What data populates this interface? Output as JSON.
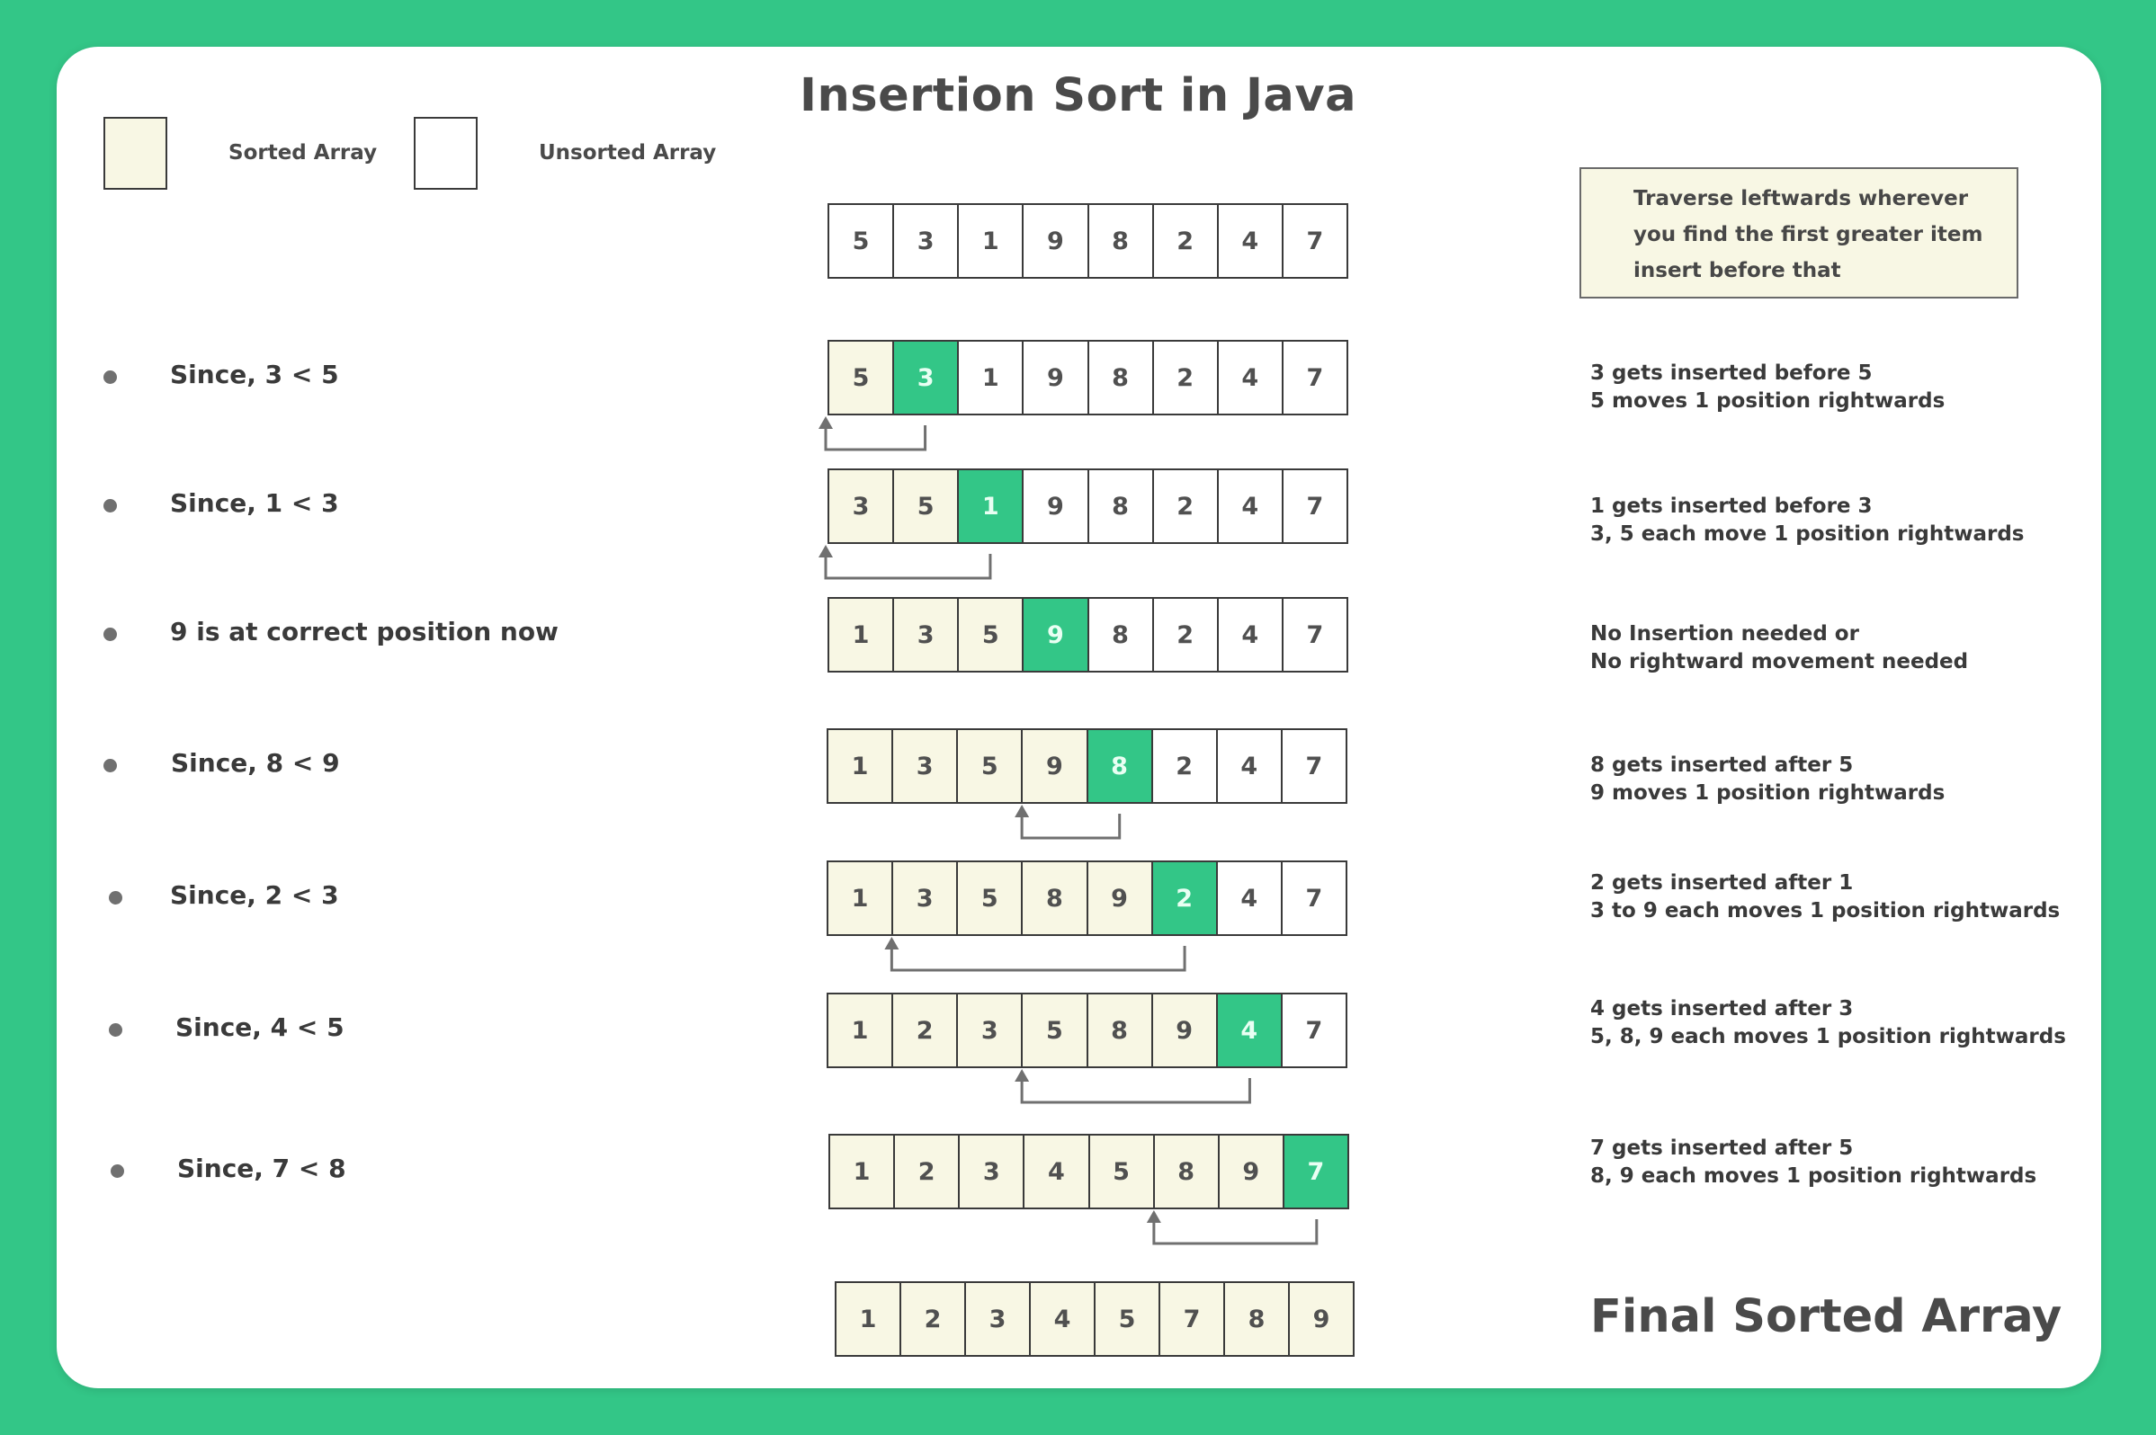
{
  "title": "Insertion Sort in Java",
  "legend": {
    "sorted_label": "Sorted Array",
    "unsorted_label": "Unsorted Array"
  },
  "colors": {
    "background": "#33c687",
    "sorted_fill": "#f8f7e4",
    "unsorted_fill": "#ffffff",
    "current_fill": "#33c687",
    "text": "#4a4a4a",
    "arrow": "#707070"
  },
  "hint_box": {
    "lines": [
      "Traverse leftwards wherever",
      "you find the first greater item",
      "insert before that"
    ]
  },
  "initial_array": {
    "values": [
      5,
      3,
      1,
      9,
      8,
      2,
      4,
      7
    ],
    "states": [
      "u",
      "u",
      "u",
      "u",
      "u",
      "u",
      "u",
      "u"
    ]
  },
  "steps": [
    {
      "label": "Since, 3 < 5",
      "values": [
        5,
        3,
        1,
        9,
        8,
        2,
        4,
        7
      ],
      "states": [
        "s",
        "c",
        "u",
        "u",
        "u",
        "u",
        "u",
        "u"
      ],
      "arrow": {
        "from_index": 1,
        "to_index": 0
      },
      "note_lines": [
        "3 gets inserted before 5",
        "5 moves 1 position rightwards"
      ]
    },
    {
      "label": "Since, 1 < 3",
      "values": [
        3,
        5,
        1,
        9,
        8,
        2,
        4,
        7
      ],
      "states": [
        "s",
        "s",
        "c",
        "u",
        "u",
        "u",
        "u",
        "u"
      ],
      "arrow": {
        "from_index": 2,
        "to_index": 0
      },
      "note_lines": [
        "1 gets inserted before 3",
        "3, 5 each move 1 position rightwards"
      ]
    },
    {
      "label": "9 is at correct position now",
      "values": [
        1,
        3,
        5,
        9,
        8,
        2,
        4,
        7
      ],
      "states": [
        "s",
        "s",
        "s",
        "c",
        "u",
        "u",
        "u",
        "u"
      ],
      "arrow": null,
      "note_lines": [
        "No Insertion needed or",
        "No rightward movement needed"
      ]
    },
    {
      "label": "Since, 8 < 9",
      "values": [
        1,
        3,
        5,
        9,
        8,
        2,
        4,
        7
      ],
      "states": [
        "s",
        "s",
        "s",
        "s",
        "c",
        "u",
        "u",
        "u"
      ],
      "arrow": {
        "from_index": 4,
        "to_index": 3
      },
      "note_lines": [
        "8 gets inserted after 5",
        "9 moves 1 position rightwards"
      ]
    },
    {
      "label": "Since, 2 < 3",
      "values": [
        1,
        3,
        5,
        8,
        9,
        2,
        4,
        7
      ],
      "states": [
        "s",
        "s",
        "s",
        "s",
        "s",
        "c",
        "u",
        "u"
      ],
      "arrow": {
        "from_index": 5,
        "to_index": 1
      },
      "note_lines": [
        "2 gets inserted after 1",
        "3 to 9 each moves 1 position rightwards"
      ]
    },
    {
      "label": "Since, 4 < 5",
      "values": [
        1,
        2,
        3,
        5,
        8,
        9,
        4,
        7
      ],
      "states": [
        "s",
        "s",
        "s",
        "s",
        "s",
        "s",
        "c",
        "u"
      ],
      "arrow": {
        "from_index": 6,
        "to_index": 3
      },
      "note_lines": [
        "4 gets inserted after 3",
        "5, 8, 9 each moves 1 position rightwards"
      ]
    },
    {
      "label": "Since, 7 < 8",
      "values": [
        1,
        2,
        3,
        4,
        5,
        8,
        9,
        7
      ],
      "states": [
        "s",
        "s",
        "s",
        "s",
        "s",
        "s",
        "s",
        "c"
      ],
      "arrow": {
        "from_index": 7,
        "to_index": 5
      },
      "note_lines": [
        "7 gets inserted after 5",
        "8, 9 each moves 1 position rightwards"
      ]
    }
  ],
  "final": {
    "label": "Final Sorted Array",
    "values": [
      1,
      2,
      3,
      4,
      5,
      7,
      8,
      9
    ],
    "states": [
      "s",
      "s",
      "s",
      "s",
      "s",
      "s",
      "s",
      "s"
    ]
  }
}
